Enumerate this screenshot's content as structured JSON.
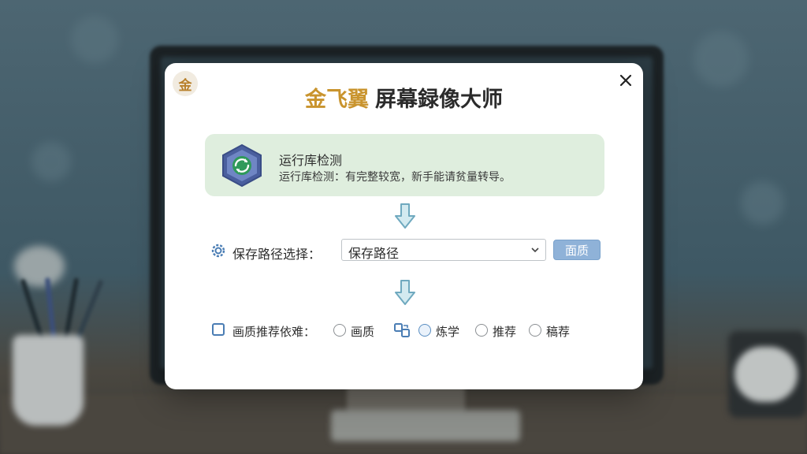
{
  "dialog": {
    "logo_char": "金",
    "title_brand": "金飞翼",
    "title_rest": "屏幕録像大师"
  },
  "status_card": {
    "title": "运行库检测",
    "description": "运行库检测：有完整较宽，新手能请贫量转导。"
  },
  "save_path": {
    "label": "保存路径选择：",
    "selected": "保存路径",
    "button_label": "面质"
  },
  "quality": {
    "label": "画质推荐依难：",
    "options": [
      "画质",
      "炼学",
      "推荐",
      "稿荐"
    ]
  },
  "colors": {
    "brand": "#c9942e",
    "accent_blue": "#8fb2d8",
    "card_green": "#dfeede"
  }
}
